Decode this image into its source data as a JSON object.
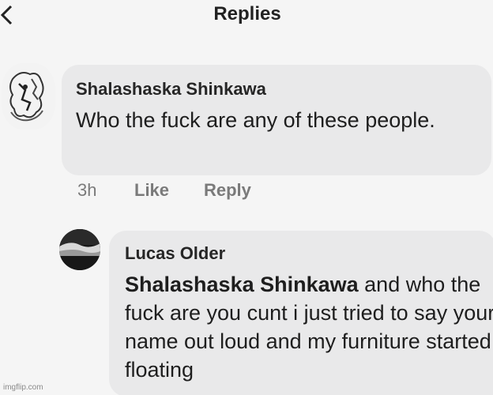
{
  "header": {
    "title": "Replies",
    "back_icon": "chevron-left-icon"
  },
  "comments": [
    {
      "author": "Shalashaska Shinkawa",
      "text": "Who the fuck are any of these people.",
      "time": "3h",
      "like_label": "Like",
      "reply_label": "Reply"
    },
    {
      "author": "Lucas Older",
      "mention": "Shalashaska Shinkawa",
      "text": " and who the fuck are you cunt i just tried to say your name out loud and my furniture started floating"
    }
  ],
  "watermark": "imgflip.com",
  "colors": {
    "background": "#f5f5f5",
    "bubble": "#e9e9ea",
    "muted_text": "#7a7a7a"
  }
}
